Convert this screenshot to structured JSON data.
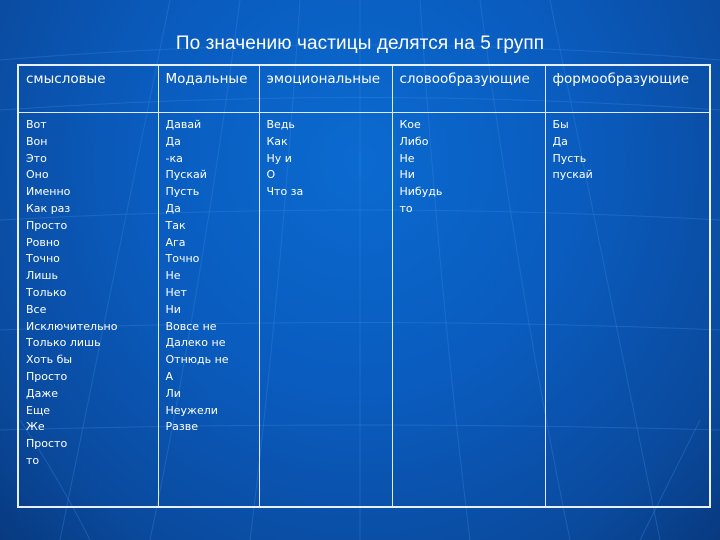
{
  "slide": {
    "title": "По значению частицы делятся на 5 групп",
    "background_color": "#0a5bbd",
    "table": {
      "headers": [
        "смысловые",
        "Модальные",
        "эмоциональные",
        "словообразующие",
        "формообразующие"
      ],
      "columns": [
        [
          "Вот",
          "Вон",
          "Это",
          "Оно",
          "Именно",
          "Как раз",
          "Просто",
          "Ровно",
          "Точно",
          "Лишь",
          "Только",
          "Все",
          "Исключительно",
          "Только лишь",
          "Хоть бы",
          "Просто",
          "Даже",
          "Еще",
          "Же",
          "Просто",
          "то"
        ],
        [
          "Давай",
          "Да",
          "-ка",
          "Пускай",
          "Пусть",
          "Да",
          "Так",
          "Ага",
          "Точно",
          "Не",
          "Нет",
          "Ни",
          "Вовсе не",
          "Далеко не",
          "Отнюдь не",
          "А",
          "Ли",
          "Неужели",
          "Разве"
        ],
        [
          "Ведь",
          "Как",
          "Ну и",
          "О",
          "Что за"
        ],
        [
          "Кое",
          "Либо",
          "Не",
          "Ни",
          "Нибудь",
          "то"
        ],
        [
          "Бы",
          "Да",
          "Пусть",
          "пускай"
        ]
      ]
    }
  }
}
